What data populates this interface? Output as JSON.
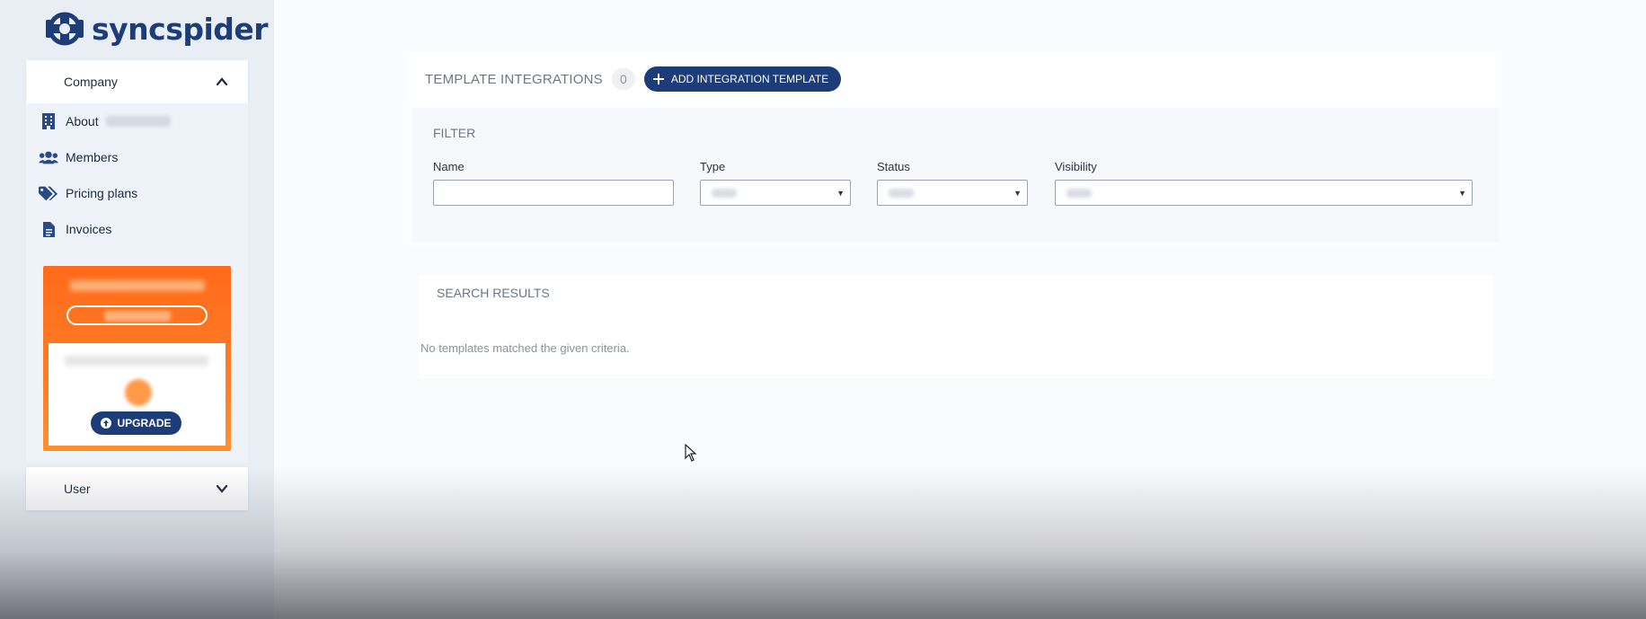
{
  "brand": {
    "name": "syncspider",
    "color": "#1c3d78"
  },
  "sidebar": {
    "company_label": "Company",
    "user_label": "User",
    "items": [
      {
        "label": "About",
        "icon": "building-icon"
      },
      {
        "label": "Members",
        "icon": "users-icon"
      },
      {
        "label": "Pricing plans",
        "icon": "tags-icon"
      },
      {
        "label": "Invoices",
        "icon": "file-icon"
      }
    ],
    "promo": {
      "upgrade_label": "UPGRADE",
      "accent": "#ff7a20"
    }
  },
  "main": {
    "templates_title": "TEMPLATE INTEGRATIONS",
    "templates_count": "0",
    "add_button_label": "ADD INTEGRATION TEMPLATE",
    "filter": {
      "title": "FILTER",
      "name_label": "Name",
      "name_value": "",
      "type_label": "Type",
      "status_label": "Status",
      "visibility_label": "Visibility"
    },
    "results": {
      "title": "SEARCH RESULTS",
      "empty_message": "No templates matched the given criteria."
    }
  }
}
